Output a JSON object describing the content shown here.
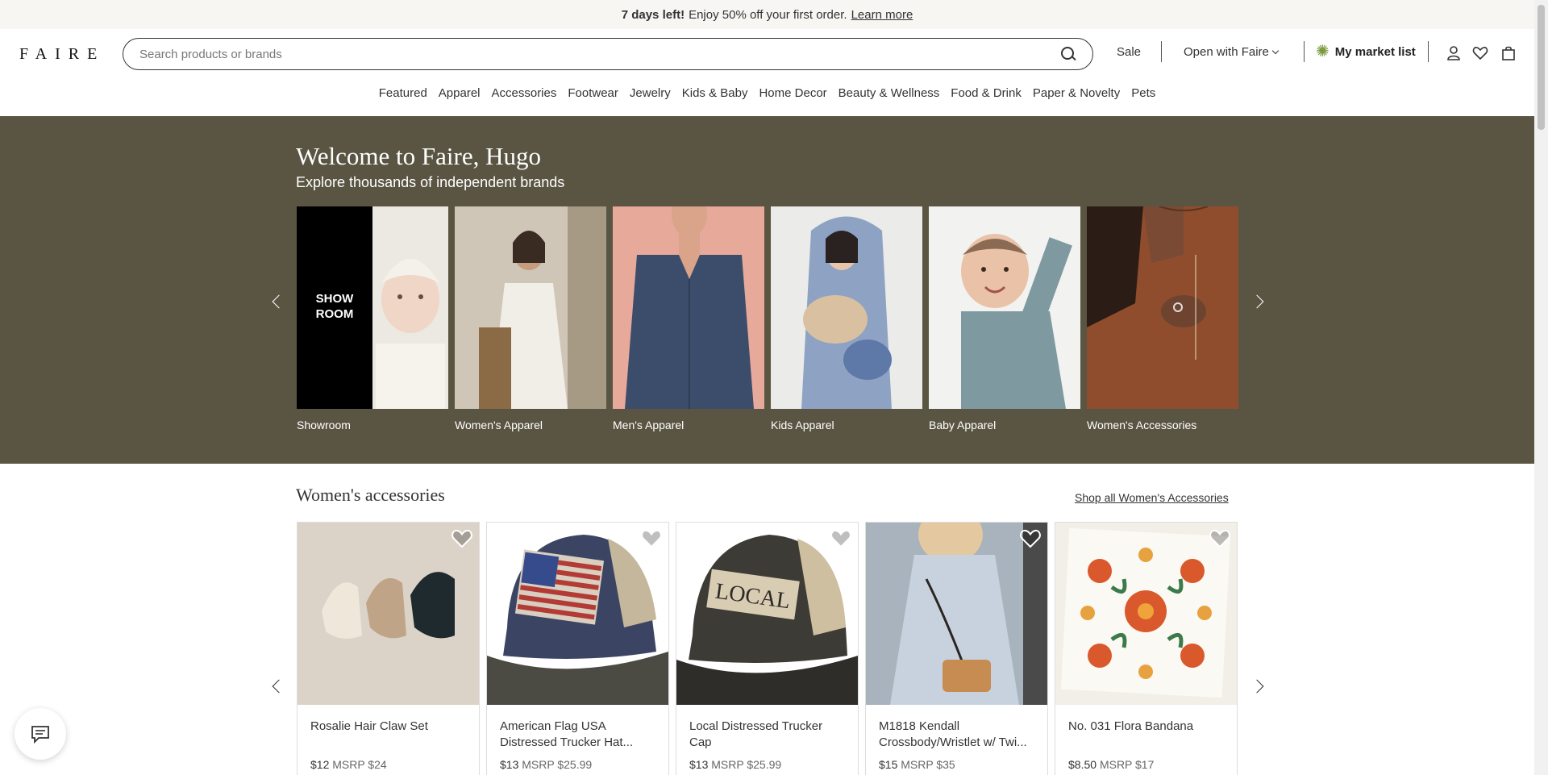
{
  "banner": {
    "bold": "7 days left!",
    "text": "Enjoy 50% off your first order.",
    "link": "Learn more"
  },
  "header": {
    "logo": "FAIRE",
    "search_placeholder": "Search products or brands",
    "sale": "Sale",
    "open_with": "Open with Faire",
    "market_list": "My market list",
    "icons": [
      "account-icon",
      "heart-icon",
      "bag-icon"
    ]
  },
  "nav": [
    "Featured",
    "Apparel",
    "Accessories",
    "Footwear",
    "Jewelry",
    "Kids & Baby",
    "Home Decor",
    "Beauty & Wellness",
    "Food & Drink",
    "Paper & Novelty",
    "Pets"
  ],
  "hero": {
    "title": "Welcome to Faire, Hugo",
    "subtitle": "Explore thousands of independent brands",
    "showroom_overlay_1": "SHOW",
    "showroom_overlay_2": "ROOM",
    "categories": [
      {
        "label": "Showroom"
      },
      {
        "label": "Women's Apparel"
      },
      {
        "label": "Men's Apparel"
      },
      {
        "label": "Kids Apparel"
      },
      {
        "label": "Baby Apparel"
      },
      {
        "label": "Women's Accessories"
      }
    ]
  },
  "section": {
    "title": "Women's accessories",
    "shop_all": "Shop all Women's Accessories",
    "products": [
      {
        "name": "Rosalie Hair Claw Set",
        "price": "$12",
        "msrp": "MSRP $24"
      },
      {
        "name": "American Flag USA Distressed Trucker Hat...",
        "price": "$13",
        "msrp": "MSRP $25.99"
      },
      {
        "name": "Local Distressed Trucker Cap",
        "price": "$13",
        "msrp": "MSRP $25.99"
      },
      {
        "name": "M1818 Kendall Crossbody/Wristlet w/ Twi...",
        "price": "$15",
        "msrp": "MSRP $35"
      },
      {
        "name": "No. 031 Flora Bandana",
        "price": "$8.50",
        "msrp": "MSRP $17"
      }
    ]
  },
  "colors": {
    "hero_bg": "#5a5543",
    "banner_bg": "#f8f6f3",
    "accent_green": "#7a9a3c"
  }
}
